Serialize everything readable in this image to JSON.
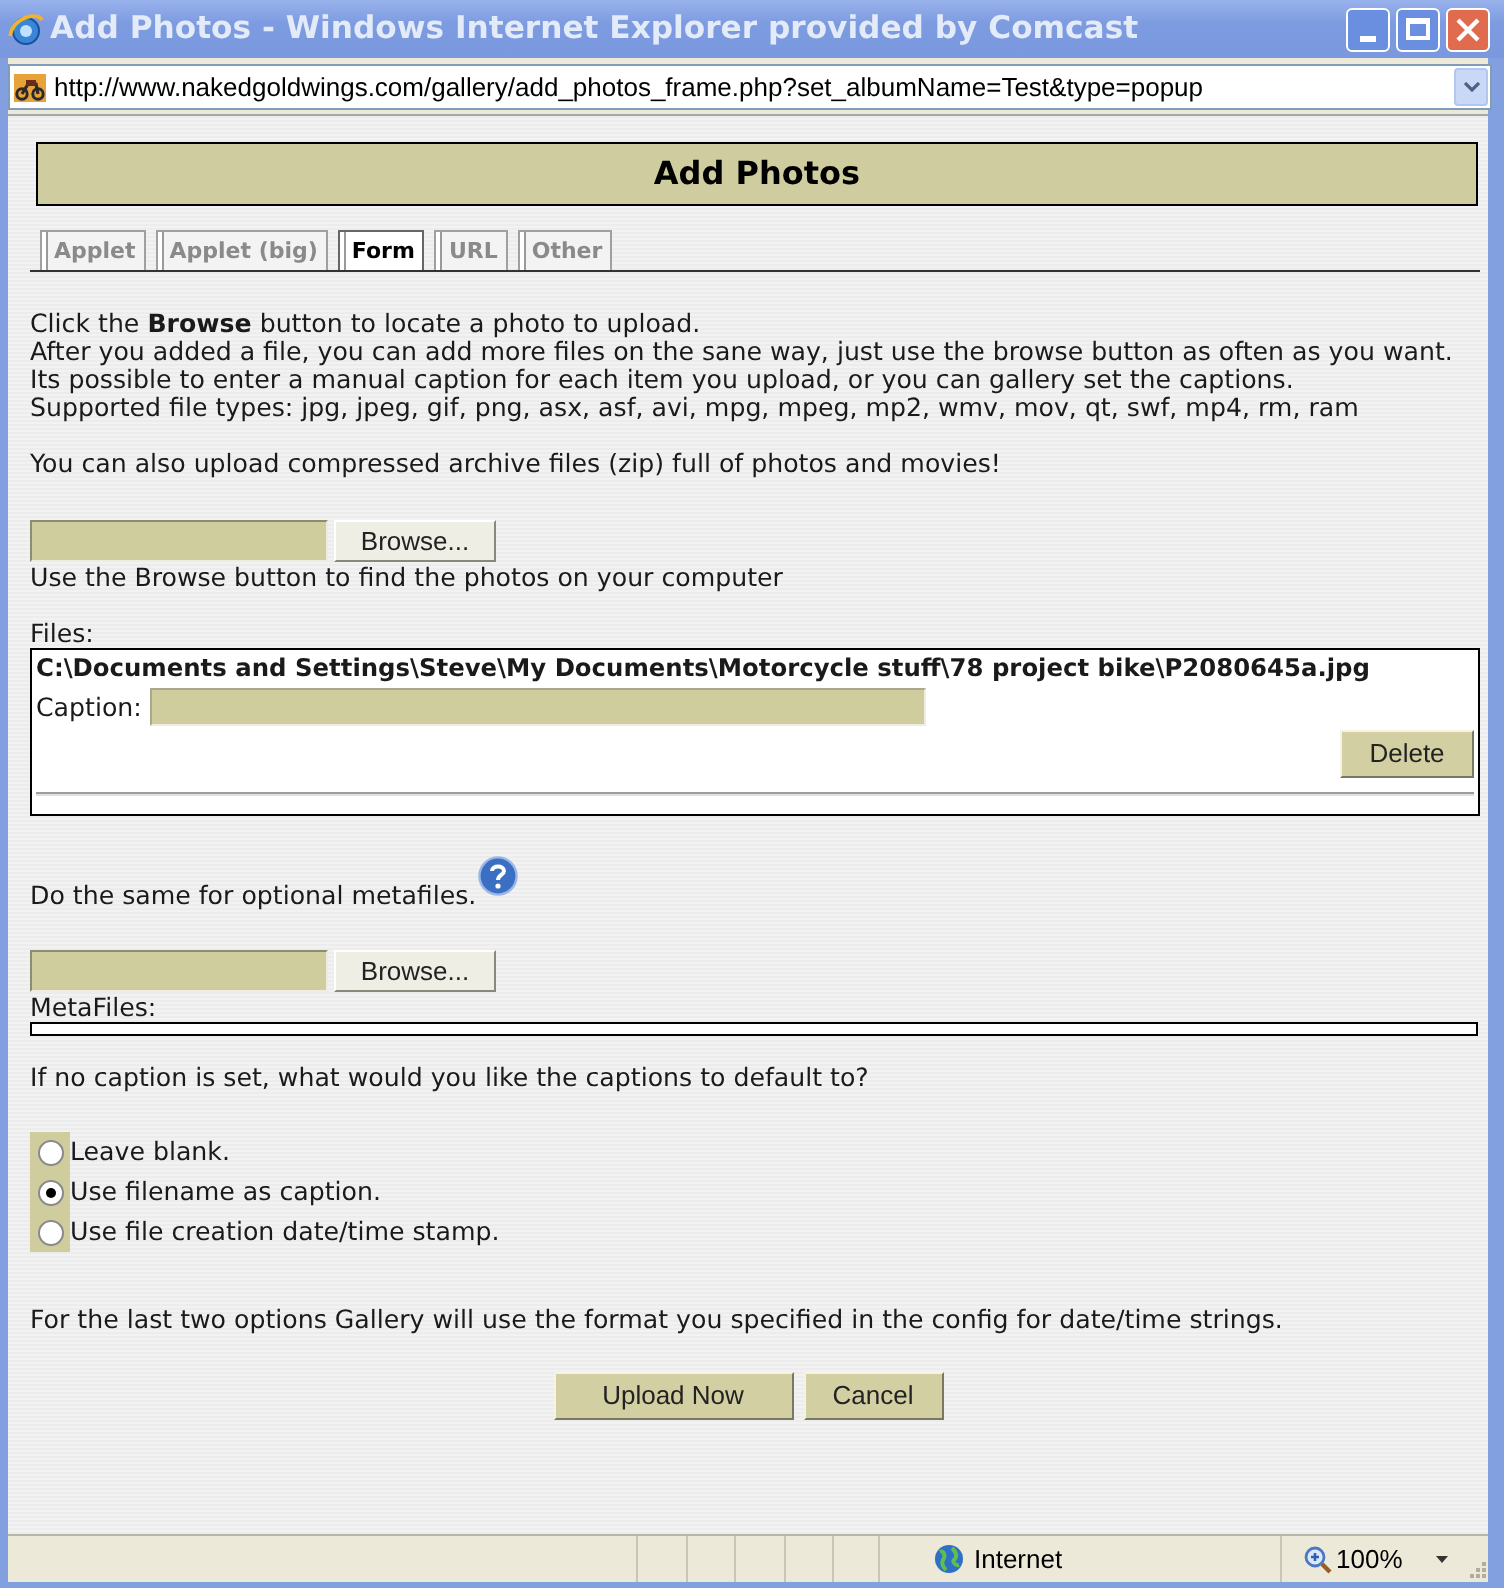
{
  "window": {
    "title": "Add Photos - Windows Internet Explorer provided by Comcast"
  },
  "address_bar": {
    "url": "http://www.nakedgoldwings.com/gallery/add_photos_frame.php?set_albumName=Test&type=popup"
  },
  "page": {
    "heading": "Add Photos",
    "tabs": [
      {
        "label": "Applet",
        "selected": false
      },
      {
        "label": "Applet (big)",
        "selected": false
      },
      {
        "label": "Form",
        "selected": true
      },
      {
        "label": "URL",
        "selected": false
      },
      {
        "label": "Other",
        "selected": false
      }
    ],
    "intro": [
      "Click the **Browse** button to locate a photo to upload.",
      "After you added a file, you can add more files on the sane way, just use the browse button as often as you want.",
      "Its possible to enter a manual caption for each item you upload, or you can gallery set the captions.",
      "Supported file types: jpg, jpeg, gif, png, asx, asf, avi, mpg, mpeg, mp2, wmv, mov, qt, swf, mp4, rm, ram"
    ],
    "archive_note": "You can also upload compressed archive files (zip) full of photos and movies!",
    "upload": {
      "browse_button": "Browse...",
      "hint": "Use the Browse button to find the photos on your computer"
    },
    "files": {
      "label": "Files:",
      "items": [
        {
          "path": "C:\\Documents and Settings\\Steve\\My Documents\\Motorcycle stuff\\78 project bike\\P2080645a.jpg",
          "caption_label": "Caption:",
          "delete_button": "Delete"
        }
      ]
    },
    "metafiles": {
      "prompt": "Do the same for optional metafiles.",
      "browse_button": "Browse...",
      "label": "MetaFiles:"
    },
    "caption_default": {
      "question": "If no caption is set, what would you like the captions to default to?",
      "options": [
        {
          "label": "Leave blank.",
          "selected": false
        },
        {
          "label": "Use filename as caption.",
          "selected": true
        },
        {
          "label": "Use file creation date/time stamp.",
          "selected": false
        }
      ]
    },
    "format_note": "For the last two options Gallery will use the format you specified in the config for date/time strings.",
    "buttons": [
      "Upload Now",
      "Cancel"
    ]
  },
  "status_bar": {
    "zone": "Internet",
    "zoom": "100%"
  }
}
